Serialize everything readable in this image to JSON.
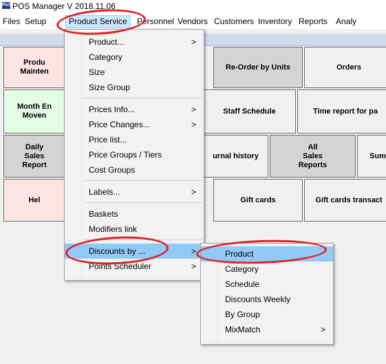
{
  "window": {
    "title": "POS Manager V 2018.11.06",
    "logo": "PoS"
  },
  "menubar": [
    {
      "label": "Files"
    },
    {
      "label": "Setup"
    },
    {
      "label": "Product Service"
    },
    {
      "label": "Personnel"
    },
    {
      "label": "Vendors"
    },
    {
      "label": "Customers"
    },
    {
      "label": "Inventory"
    },
    {
      "label": "Reports"
    },
    {
      "label": "Analy"
    }
  ],
  "tiles": [
    {
      "label": "Produ\nMainten",
      "color": "#fde4e4"
    },
    {
      "label": "Re-Order by Units",
      "color": "#d4d4d4"
    },
    {
      "label": "Orders",
      "color": "#f0f0f0"
    },
    {
      "label": "Month En\nMoven",
      "color": "#e4fbe4"
    },
    {
      "label": "Staff Schedule",
      "color": "#f0f0f0"
    },
    {
      "label": "Time report for pa",
      "color": "#f0f0f0"
    },
    {
      "label": "Daily\nSales\nReport",
      "color": "#d4d4d4"
    },
    {
      "label": "urnal history",
      "color": "#f0f0f0"
    },
    {
      "label": "All\nSales\nReports",
      "color": "#d4d4d4"
    },
    {
      "label": "Sum",
      "color": "#f0f0f0"
    },
    {
      "label": "Hel",
      "color": "#fde4e4"
    },
    {
      "label": "Gift cards",
      "color": "#f0f0f0"
    },
    {
      "label": "Gift cards transact",
      "color": "#f0f0f0"
    }
  ],
  "product_service_menu": {
    "items": [
      {
        "label": "Product...",
        "submenu": true
      },
      {
        "label": "Category",
        "submenu": false
      },
      {
        "label": "Size",
        "submenu": false
      },
      {
        "label": "Size Group",
        "submenu": false
      },
      {
        "label": "Prices Info...",
        "submenu": true
      },
      {
        "label": "Price Changes...",
        "submenu": true
      },
      {
        "label": "Price list...",
        "submenu": false
      },
      {
        "label": "Price Groups / Tiers",
        "submenu": false
      },
      {
        "label": "Cost Groups",
        "submenu": false
      },
      {
        "label": "Labels...",
        "submenu": true
      },
      {
        "label": "Baskets",
        "submenu": false
      },
      {
        "label": "Modifiers link",
        "submenu": false
      },
      {
        "label": "Discounts by ...",
        "submenu": true
      },
      {
        "label": "Points Scheduler",
        "submenu": true
      }
    ],
    "arrow": ">"
  },
  "discounts_submenu": {
    "items": [
      {
        "label": "Product",
        "submenu": false
      },
      {
        "label": "Category",
        "submenu": false
      },
      {
        "label": "Schedule",
        "submenu": false
      },
      {
        "label": "Discounts Weekly",
        "submenu": false
      },
      {
        "label": "By Group",
        "submenu": false
      },
      {
        "label": "MixMatch",
        "submenu": true
      }
    ],
    "arrow": ">"
  },
  "colors": {
    "highlight": "#91c9f7",
    "annotation_ring": "#e32023",
    "menubar_active": "#cce8ff"
  }
}
